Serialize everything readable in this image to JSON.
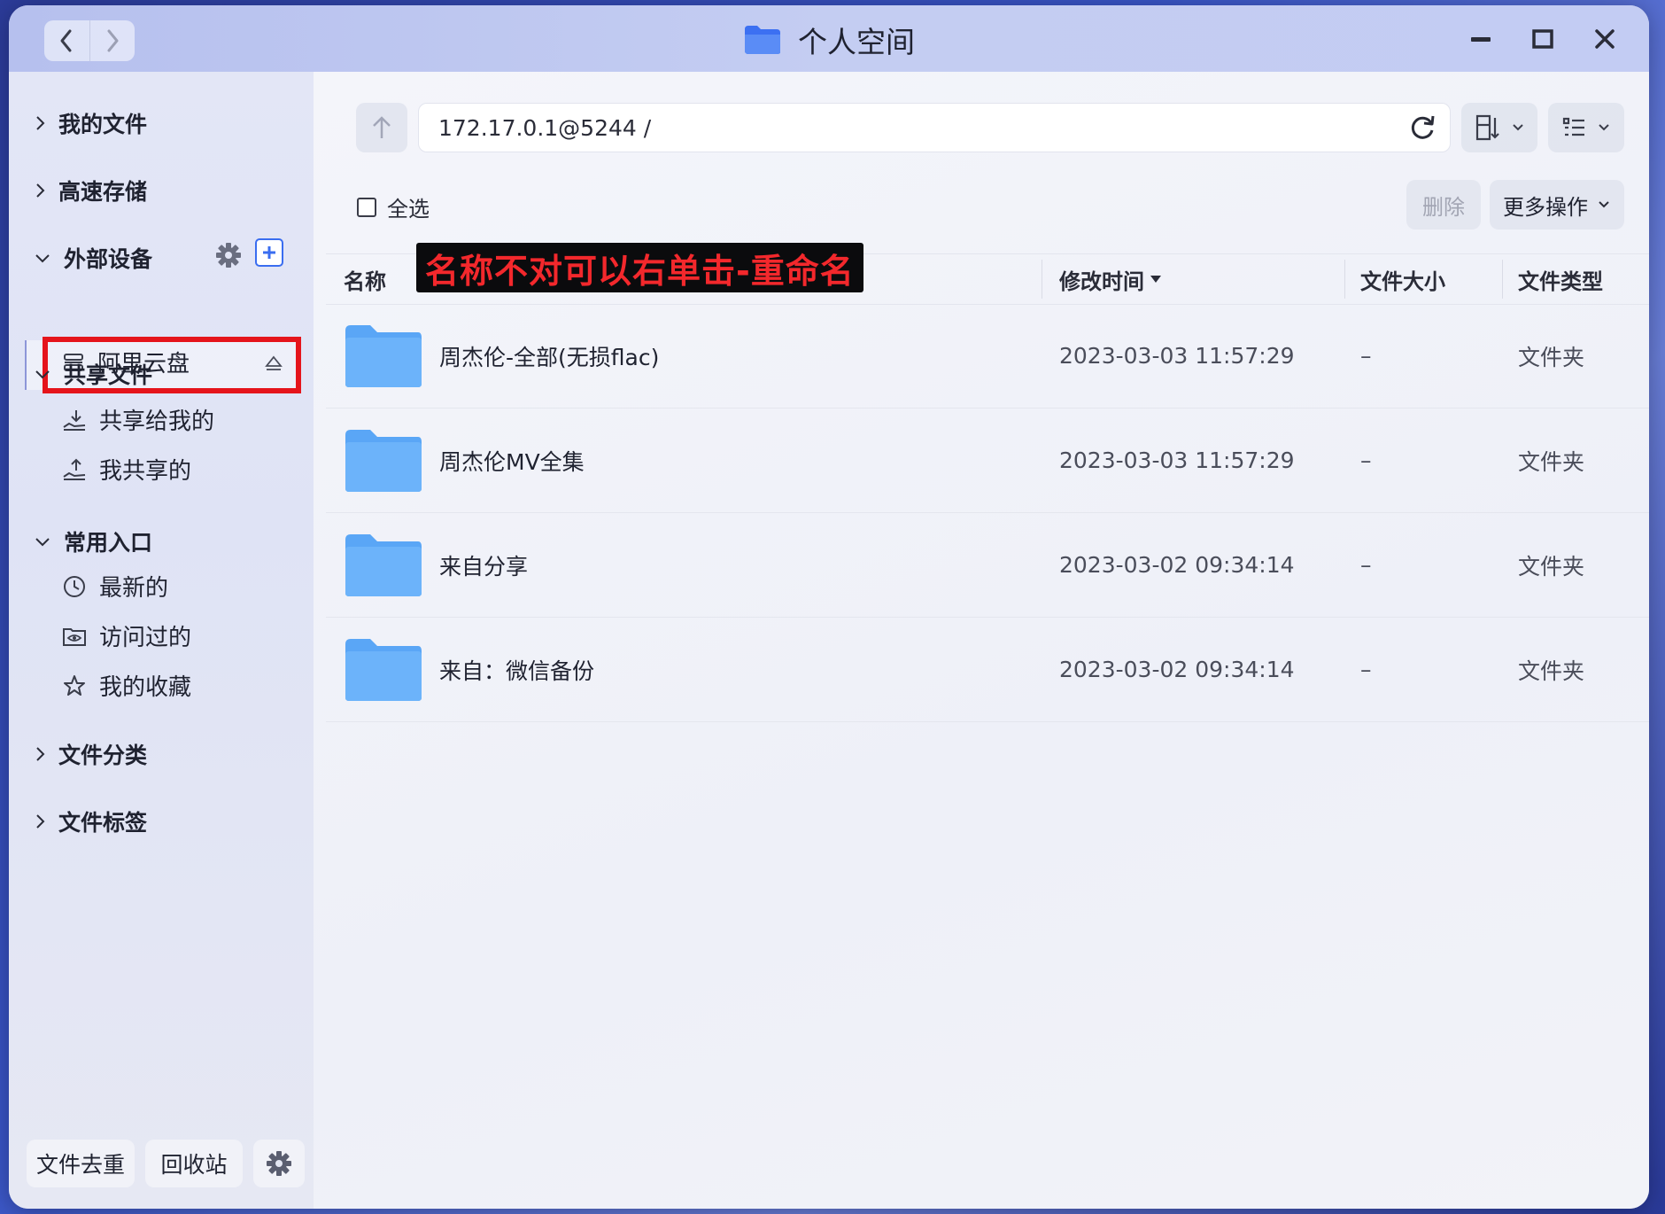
{
  "window": {
    "title": "个人空间",
    "folder_icon": "folder-icon"
  },
  "sidebar": {
    "my_files": "我的文件",
    "fast_storage": "高速存储",
    "external": {
      "label": "外部设备",
      "items": [
        {
          "label": "阿里云盘"
        }
      ]
    },
    "shared": {
      "label": "共享文件",
      "items": [
        {
          "label": "共享给我的"
        },
        {
          "label": "我共享的"
        }
      ]
    },
    "common": {
      "label": "常用入口",
      "items": [
        {
          "label": "最新的"
        },
        {
          "label": "访问过的"
        },
        {
          "label": "我的收藏"
        }
      ]
    },
    "categories": "文件分类",
    "tags": "文件标签",
    "bottom": {
      "dedupe": "文件去重",
      "recycle": "回收站"
    }
  },
  "toolbar": {
    "path": "172.17.0.1@5244 /",
    "select_all": "全选",
    "delete": "删除",
    "more": "更多操作"
  },
  "annotation": "名称不对可以右单击-重命名",
  "table": {
    "columns": {
      "name": "名称",
      "mtime": "修改时间",
      "size": "文件大小",
      "type": "文件类型"
    },
    "rows": [
      {
        "name": "周杰伦-全部(无损flac)",
        "mtime": "2023-03-03 11:57:29",
        "size": "–",
        "type": "文件夹"
      },
      {
        "name": "周杰伦MV全集",
        "mtime": "2023-03-03 11:57:29",
        "size": "–",
        "type": "文件夹"
      },
      {
        "name": "来自分享",
        "mtime": "2023-03-02 09:34:14",
        "size": "–",
        "type": "文件夹"
      },
      {
        "name": "来自：微信备份",
        "mtime": "2023-03-02 09:34:14",
        "size": "–",
        "type": "文件夹"
      }
    ]
  },
  "colors": {
    "accent": "#3a6df0",
    "highlight": "#e5141b",
    "annotation_text": "#f3282c"
  }
}
